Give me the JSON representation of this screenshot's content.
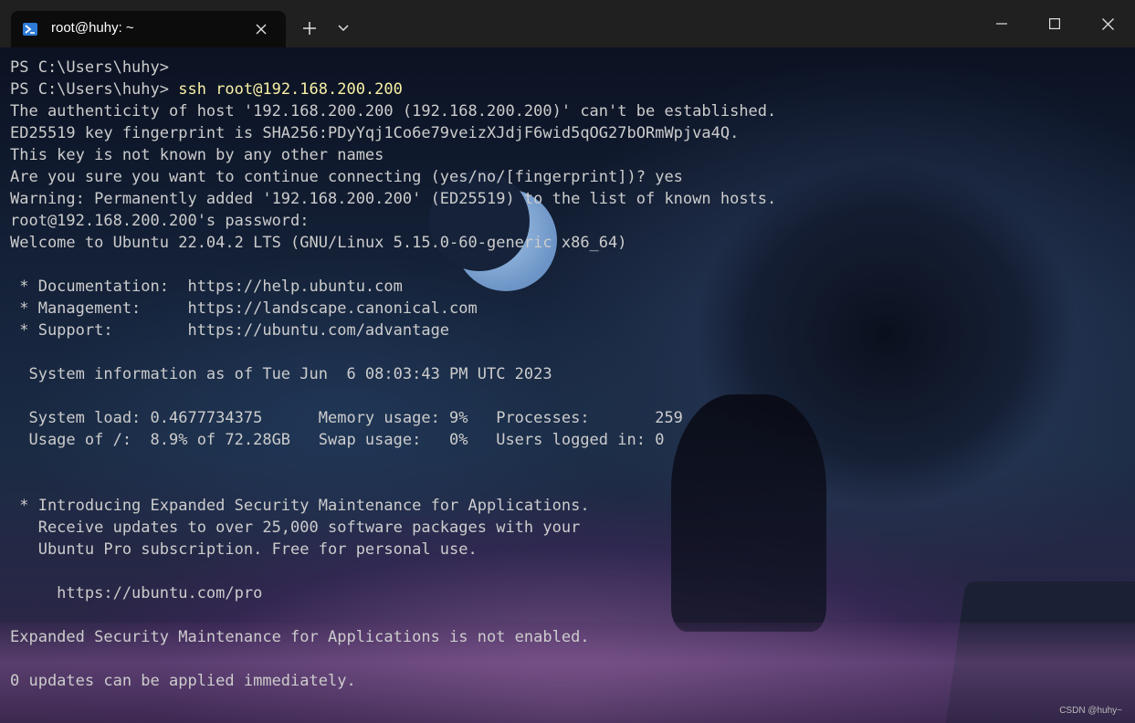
{
  "tab": {
    "icon": "powershell-icon",
    "title": "root@huhy: ~"
  },
  "window_controls": [
    "minimize-icon",
    "maximize-icon",
    "close-icon"
  ],
  "terminal": {
    "lines": [
      {
        "prompt": "PS C:\\Users\\huhy>",
        "command": ""
      },
      {
        "prompt": "PS C:\\Users\\huhy> ",
        "command": "ssh root@192.168.200.200"
      },
      {
        "prompt": "The authenticity of host '192.168.200.200 (192.168.200.200)' can't be established.",
        "command": ""
      },
      {
        "prompt": "ED25519 key fingerprint is SHA256:PDyYqj1Co6e79veizXJdjF6wid5qOG27bORmWpjva4Q.",
        "command": ""
      },
      {
        "prompt": "This key is not known by any other names",
        "command": ""
      },
      {
        "prompt": "Are you sure you want to continue connecting (yes/no/[fingerprint])? yes",
        "command": ""
      },
      {
        "prompt": "Warning: Permanently added '192.168.200.200' (ED25519) to the list of known hosts.",
        "command": ""
      },
      {
        "prompt": "root@192.168.200.200's password:",
        "command": ""
      },
      {
        "prompt": "Welcome to Ubuntu 22.04.2 LTS (GNU/Linux 5.15.0-60-generic x86_64)",
        "command": ""
      },
      {
        "prompt": "",
        "command": ""
      },
      {
        "prompt": " * Documentation:  https://help.ubuntu.com",
        "command": ""
      },
      {
        "prompt": " * Management:     https://landscape.canonical.com",
        "command": ""
      },
      {
        "prompt": " * Support:        https://ubuntu.com/advantage",
        "command": ""
      },
      {
        "prompt": "",
        "command": ""
      },
      {
        "prompt": "  System information as of Tue Jun  6 08:03:43 PM UTC 2023",
        "command": ""
      },
      {
        "prompt": "",
        "command": ""
      },
      {
        "prompt": "  System load: 0.4677734375      Memory usage: 9%   Processes:       259",
        "command": ""
      },
      {
        "prompt": "  Usage of /:  8.9% of 72.28GB   Swap usage:   0%   Users logged in: 0",
        "command": ""
      },
      {
        "prompt": "",
        "command": ""
      },
      {
        "prompt": "",
        "command": ""
      },
      {
        "prompt": " * Introducing Expanded Security Maintenance for Applications.",
        "command": ""
      },
      {
        "prompt": "   Receive updates to over 25,000 software packages with your",
        "command": ""
      },
      {
        "prompt": "   Ubuntu Pro subscription. Free for personal use.",
        "command": ""
      },
      {
        "prompt": "",
        "command": ""
      },
      {
        "prompt": "     https://ubuntu.com/pro",
        "command": ""
      },
      {
        "prompt": "",
        "command": ""
      },
      {
        "prompt": "Expanded Security Maintenance for Applications is not enabled.",
        "command": ""
      },
      {
        "prompt": "",
        "command": ""
      },
      {
        "prompt": "0 updates can be applied immediately.",
        "command": ""
      }
    ]
  },
  "watermark": "CSDN @huhy~",
  "colors": {
    "titlebar": "#202020",
    "tab": "#0c0c0c",
    "text": "#cccccc",
    "command": "#f9f1a5"
  }
}
